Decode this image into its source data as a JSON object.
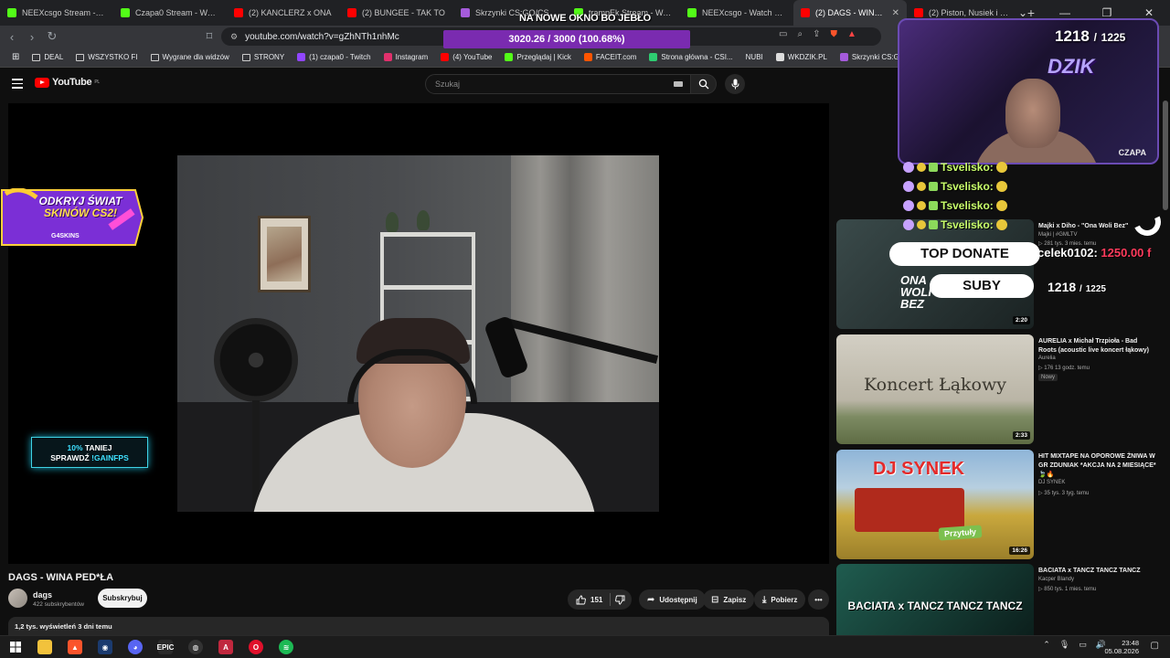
{
  "browser": {
    "tabs": [
      {
        "title": "NEEXcsgo Stream - Watch Li",
        "color": "#53fc18",
        "active": false
      },
      {
        "title": "Czapa0 Stream - Watch Li",
        "color": "#53fc18",
        "active": false
      },
      {
        "title": "(2) KANCLERZ x ONA",
        "color": "#ff0000",
        "active": false
      },
      {
        "title": "(2) BUNGEE - TAK TO",
        "color": "#ff0000",
        "active": false
      },
      {
        "title": "Skrzynki CS:GO/CS2 | G4S",
        "color": "#a55bdb",
        "active": false
      },
      {
        "title": "trampEk Stream - Watch L",
        "color": "#53fc18",
        "active": false
      },
      {
        "title": "NEEXcsgo - Watch clips o",
        "color": "#53fc18",
        "active": false
      },
      {
        "title": "(2) DAGS - WINA PED",
        "color": "#ff0000",
        "active": true
      },
      {
        "title": "(2) Piston, Nusiek i Romek",
        "color": "#ff0000",
        "active": false
      }
    ],
    "url": "youtube.com/watch?v=gZhNTh1nhMc",
    "bookmarks": [
      {
        "label": "DEAL",
        "type": "folder"
      },
      {
        "label": "WSZYSTKO FI",
        "type": "folder"
      },
      {
        "label": "Wygrane dla widzów",
        "type": "folder"
      },
      {
        "label": "STRONY",
        "type": "folder"
      },
      {
        "label": "(1) czapa0 - Twitch",
        "type": "site",
        "color": "#9146ff"
      },
      {
        "label": "Instagram",
        "type": "site",
        "color": "#e1306c"
      },
      {
        "label": "(4) YouTube",
        "type": "site",
        "color": "#ff0000"
      },
      {
        "label": "Przeglądaj | Kick",
        "type": "site",
        "color": "#53fc18"
      },
      {
        "label": "FACEIT.com",
        "type": "site",
        "color": "#ff5500"
      },
      {
        "label": "Strona główna - CSI...",
        "type": "site",
        "color": "#2ecc71"
      },
      {
        "label": "NUBI",
        "type": "plain"
      },
      {
        "label": "WKDZIK.PL",
        "type": "site",
        "color": "#dddddd"
      },
      {
        "label": "Skrzynki CS:GO/CS",
        "type": "site",
        "color": "#a55bdb"
      }
    ]
  },
  "youtube": {
    "logo_text": "YouTube",
    "logo_region": "PL",
    "search_placeholder": "Szukaj",
    "video": {
      "title": "DAGS - WINA PED*ŁA",
      "channel": "dags",
      "subscribers": "422 subskrybentów",
      "subscribe_label": "Subskrybuj",
      "likes": "151",
      "share_label": "Udostępnij",
      "save_label": "Zapisz",
      "download_label": "Pobierz",
      "views_line": "1,2 tys. wyświetleń  3 dni temu"
    },
    "player_ads": {
      "skins_line1": "ODKRYJ ŚWIAT",
      "skins_line2": "SKINÓW CS2!",
      "skins_brand": "G4SKINS",
      "gain_line1_hl": "10%",
      "gain_line1": "TANIEJ",
      "gain_line2": "SPRAWDŹ",
      "gain_line2_hl": "!GAINFPS"
    },
    "recommendations": [
      {
        "title": "Majki x Diho - \"Ona Woli Bez\"",
        "channel": "Majki | #GMLTV",
        "meta": "▷ 281 tys.  3 mies. temu",
        "duration": "2:20",
        "badge": "",
        "thumb_text": "ONA WOLI BEZ",
        "color_a": "#3a4a4a",
        "color_b": "#1a2222"
      },
      {
        "title": "AURELIA x Michał Trzpioła - Bad Roots (acoustic live koncert łąkowy)",
        "channel": "Aurelia",
        "meta": "▷ 176  13 godz. temu",
        "duration": "2:33",
        "badge": "Nowy",
        "thumb_text": "Koncert Łąkowy",
        "color_a": "#c9c4b8",
        "color_b": "#8d8a7c"
      },
      {
        "title": "HIT MIXTAPE NA OPOROWE ŻNIWA W GR ZDUNIAK *AKCJA NA 2 MIESIĄCE* 🍃🔥",
        "channel": "DJ SYNEK",
        "meta": "▷ 35 tys.  3 tyg. temu",
        "duration": "16:26",
        "badge": "",
        "thumb_text": "DJ SYNEK",
        "thumb_sub": "Przytuły",
        "color_a": "#7aa0c8",
        "color_b": "#c8a23a"
      },
      {
        "title": "BACIATA x TANCZ TANCZ TANCZ",
        "channel": "Kacper Blandy",
        "meta": "▷ 850 tys.  1 mies. temu",
        "duration": "",
        "badge": "",
        "thumb_text": "BACIATA x TANCZ TANCZ TANCZ",
        "color_a": "#1f5c4f",
        "color_b": "#0c1f1c"
      }
    ]
  },
  "stream_overlay": {
    "top_caption": "NA NOWE OKNO BO JEBŁO",
    "goal_text": "3020.26 / 3000 (100.68%)",
    "goal_progress": 1.0068,
    "sub_count": "1218",
    "sub_goal": "1225",
    "brand": "DZIK",
    "cam_label": "CZAPA",
    "chat_name": "Tsvelisko:",
    "top_donate_label": "TOP DONATE",
    "top_donate_name": "celek0102:",
    "top_donate_amount": "1250.00 f",
    "subs_label": "SUBY",
    "accent_purple": "#7a2bb0"
  },
  "taskbar": {
    "time": "23:48",
    "date": "05.08.2026"
  }
}
